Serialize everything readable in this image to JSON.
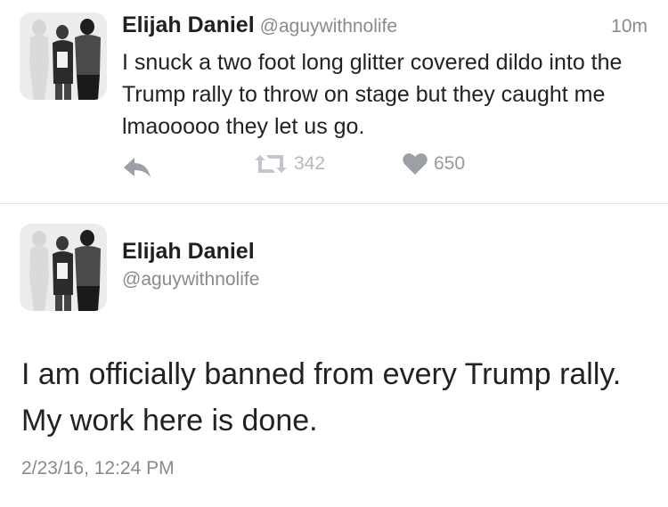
{
  "tweet1": {
    "author_name": "Elijah Daniel",
    "handle": "@aguywithnolife",
    "time": "10m",
    "text": "I snuck a two foot long glitter covered dildo into the Trump rally to throw on stage but they caught me lmaooooo they let us go.",
    "actions": {
      "reply_icon": "reply-icon",
      "retweet_icon": "retweet-icon",
      "retweet_count": "342",
      "like_icon": "heart-icon",
      "like_count": "650"
    }
  },
  "tweet2": {
    "author_name": "Elijah Daniel",
    "handle": "@aguywithnolife",
    "text": "I am officially banned from every Trump rally. My work here is done.",
    "timestamp": "2/23/16, 12:24 PM"
  }
}
